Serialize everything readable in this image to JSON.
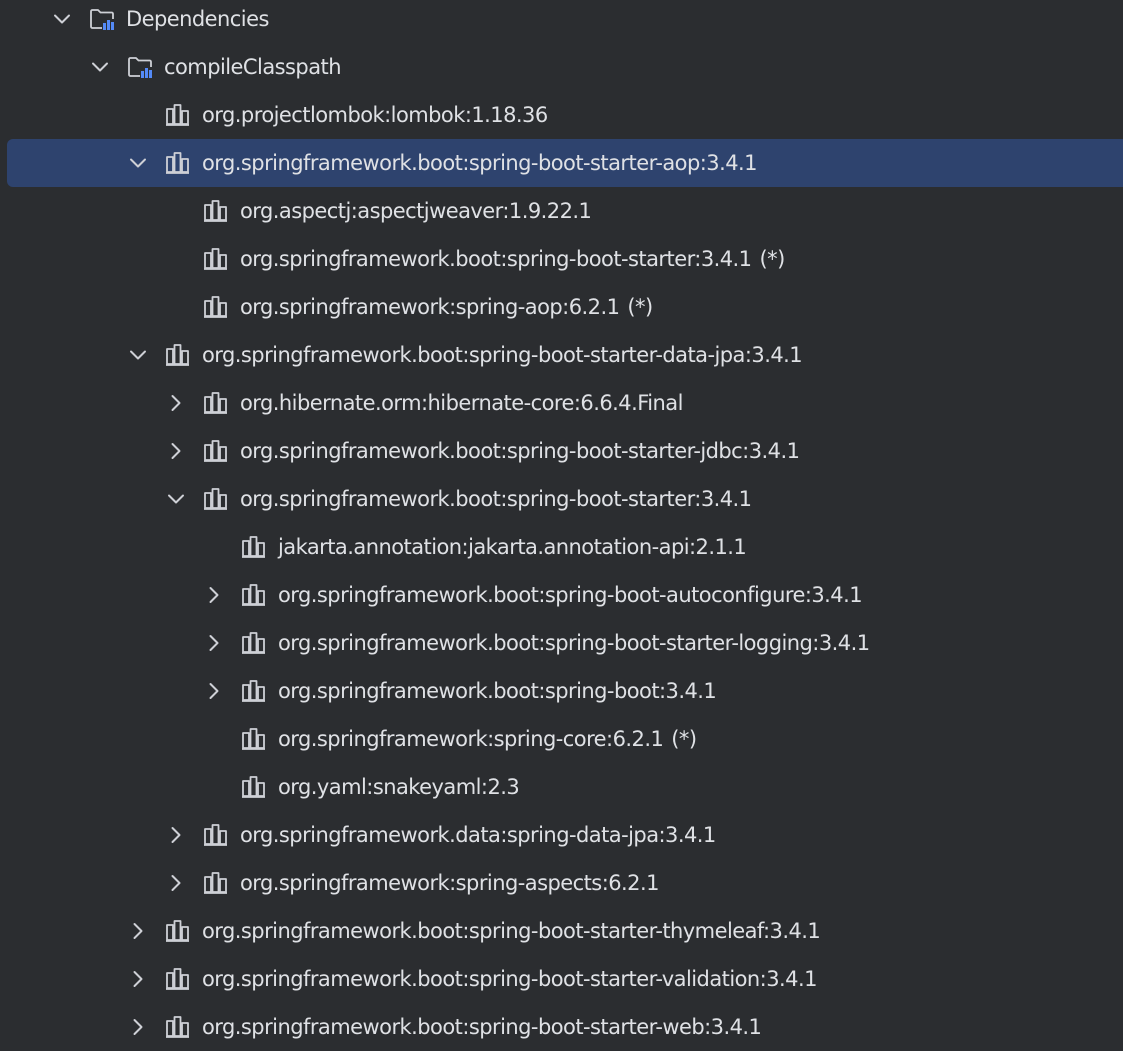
{
  "colors": {
    "background": "#2b2d30",
    "selected_row": "#2e436e",
    "text": "#dfe1e5",
    "icon_stroke": "#ced0d6",
    "icon_accent": "#548af7"
  },
  "tree": [
    {
      "label": "Dependencies",
      "suffix": "",
      "level": 0,
      "expander": "expanded",
      "icon": "folder-dependencies-icon",
      "selected": false
    },
    {
      "label": "compileClasspath",
      "suffix": "",
      "level": 1,
      "expander": "expanded",
      "icon": "folder-dependencies-icon",
      "selected": false
    },
    {
      "label": "org.projectlombok:lombok:1.18.36",
      "suffix": "",
      "level": 2,
      "expander": "none",
      "icon": "library-icon",
      "selected": false
    },
    {
      "label": "org.springframework.boot:spring-boot-starter-aop:3.4.1",
      "suffix": "",
      "level": 2,
      "expander": "expanded",
      "icon": "library-icon",
      "selected": true
    },
    {
      "label": "org.aspectj:aspectjweaver:1.9.22.1",
      "suffix": "",
      "level": 3,
      "expander": "none",
      "icon": "library-icon",
      "selected": false
    },
    {
      "label": "org.springframework.boot:spring-boot-starter:3.4.1",
      "suffix": "(*)",
      "level": 3,
      "expander": "none",
      "icon": "library-icon",
      "selected": false
    },
    {
      "label": "org.springframework:spring-aop:6.2.1",
      "suffix": "(*)",
      "level": 3,
      "expander": "none",
      "icon": "library-icon",
      "selected": false
    },
    {
      "label": "org.springframework.boot:spring-boot-starter-data-jpa:3.4.1",
      "suffix": "",
      "level": 2,
      "expander": "expanded",
      "icon": "library-icon",
      "selected": false
    },
    {
      "label": "org.hibernate.orm:hibernate-core:6.6.4.Final",
      "suffix": "",
      "level": 3,
      "expander": "collapsed",
      "icon": "library-icon",
      "selected": false
    },
    {
      "label": "org.springframework.boot:spring-boot-starter-jdbc:3.4.1",
      "suffix": "",
      "level": 3,
      "expander": "collapsed",
      "icon": "library-icon",
      "selected": false
    },
    {
      "label": "org.springframework.boot:spring-boot-starter:3.4.1",
      "suffix": "",
      "level": 3,
      "expander": "expanded",
      "icon": "library-icon",
      "selected": false
    },
    {
      "label": "jakarta.annotation:jakarta.annotation-api:2.1.1",
      "suffix": "",
      "level": 4,
      "expander": "none",
      "icon": "library-icon",
      "selected": false
    },
    {
      "label": "org.springframework.boot:spring-boot-autoconfigure:3.4.1",
      "suffix": "",
      "level": 4,
      "expander": "collapsed",
      "icon": "library-icon",
      "selected": false
    },
    {
      "label": "org.springframework.boot:spring-boot-starter-logging:3.4.1",
      "suffix": "",
      "level": 4,
      "expander": "collapsed",
      "icon": "library-icon",
      "selected": false
    },
    {
      "label": "org.springframework.boot:spring-boot:3.4.1",
      "suffix": "",
      "level": 4,
      "expander": "collapsed",
      "icon": "library-icon",
      "selected": false
    },
    {
      "label": "org.springframework:spring-core:6.2.1",
      "suffix": "(*)",
      "level": 4,
      "expander": "none",
      "icon": "library-icon",
      "selected": false
    },
    {
      "label": "org.yaml:snakeyaml:2.3",
      "suffix": "",
      "level": 4,
      "expander": "none",
      "icon": "library-icon",
      "selected": false
    },
    {
      "label": "org.springframework.data:spring-data-jpa:3.4.1",
      "suffix": "",
      "level": 3,
      "expander": "collapsed",
      "icon": "library-icon",
      "selected": false
    },
    {
      "label": "org.springframework:spring-aspects:6.2.1",
      "suffix": "",
      "level": 3,
      "expander": "collapsed",
      "icon": "library-icon",
      "selected": false
    },
    {
      "label": "org.springframework.boot:spring-boot-starter-thymeleaf:3.4.1",
      "suffix": "",
      "level": 2,
      "expander": "collapsed",
      "icon": "library-icon",
      "selected": false
    },
    {
      "label": "org.springframework.boot:spring-boot-starter-validation:3.4.1",
      "suffix": "",
      "level": 2,
      "expander": "collapsed",
      "icon": "library-icon",
      "selected": false
    },
    {
      "label": "org.springframework.boot:spring-boot-starter-web:3.4.1",
      "suffix": "",
      "level": 2,
      "expander": "collapsed",
      "icon": "library-icon",
      "selected": false
    }
  ]
}
